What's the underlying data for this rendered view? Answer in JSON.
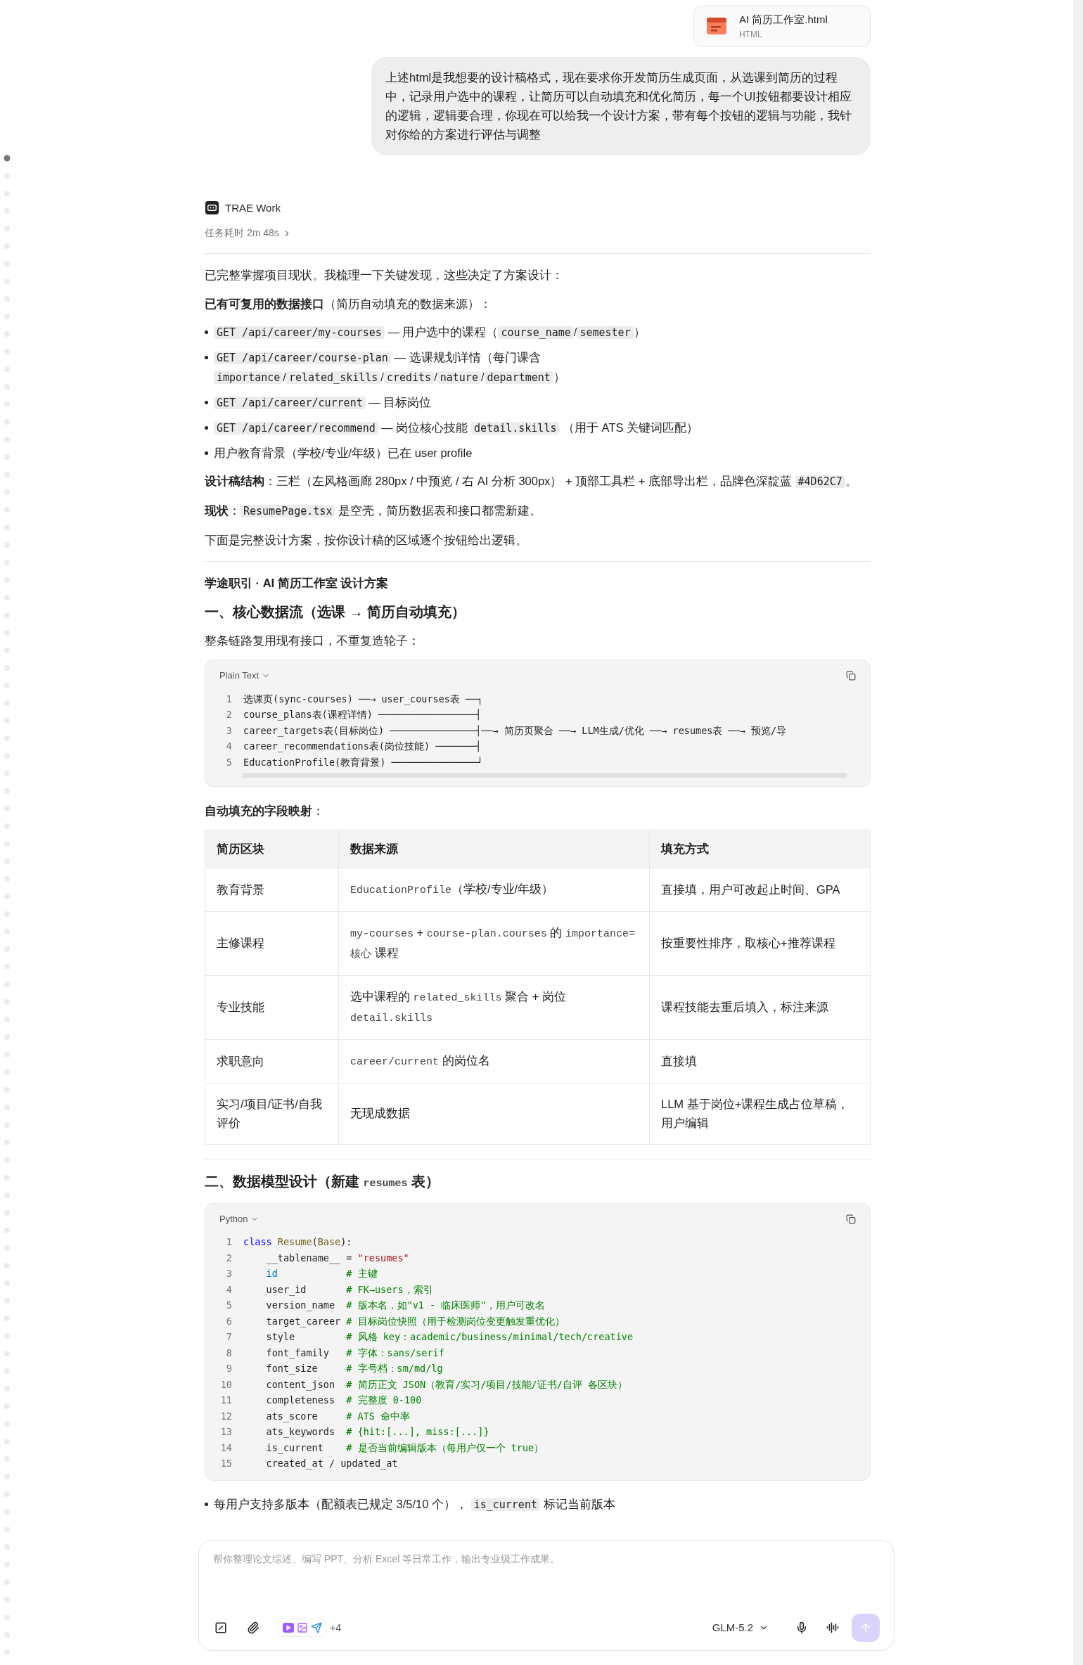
{
  "attachment": {
    "name": "AI 简历工作室.html",
    "type": "HTML"
  },
  "user_message": "上述html是我想要的设计稿格式，现在要求你开发简历生成页面，从选课到简历的过程中，记录用户选中的课程，让简历可以自动填充和优化简历，每一个UI按钮都要设计相应的逻辑，逻辑要合理，你现在可以给我一个设计方案，带有每个按钮的逻辑与功能，我针对你给的方案进行评估与调整",
  "assistant": {
    "name": "TRAE Work",
    "duration": "任务耗时 2m 48s"
  },
  "content": [
    {
      "kind": "divider"
    },
    {
      "kind": "paragraph",
      "segments": [
        {
          "kind": "text",
          "text": "已完整掌握项目现状。我梳理一下关键发现，这些决定了方案设计："
        }
      ]
    },
    {
      "kind": "paragraph",
      "segments": [
        {
          "kind": "text",
          "text": "**已有可复用的数据接口**（简历自动填充的数据来源）："
        }
      ]
    },
    {
      "kind": "bullets",
      "items": [
        {
          "segments": [
            {
              "kind": "code",
              "text": "GET /api/career/my-courses"
            },
            {
              "kind": "text",
              "text": " — 用户选中的课程（"
            },
            {
              "kind": "code",
              "text": "course_name"
            },
            {
              "kind": "text",
              "text": "/"
            },
            {
              "kind": "code",
              "text": "semester"
            },
            {
              "kind": "text",
              "text": "）"
            }
          ]
        },
        {
          "segments": [
            {
              "kind": "code",
              "text": "GET /api/career/course-plan"
            },
            {
              "kind": "text",
              "text": " — 选课规划详情（每门课含 "
            },
            {
              "kind": "code",
              "text": "importance"
            },
            {
              "kind": "text",
              "text": "/"
            },
            {
              "kind": "code",
              "text": "related_skills"
            },
            {
              "kind": "text",
              "text": "/"
            },
            {
              "kind": "code",
              "text": "credits"
            },
            {
              "kind": "text",
              "text": "/"
            },
            {
              "kind": "code",
              "text": "nature"
            },
            {
              "kind": "text",
              "text": "/"
            },
            {
              "kind": "code",
              "text": "department"
            },
            {
              "kind": "text",
              "text": "）"
            }
          ]
        },
        {
          "segments": [
            {
              "kind": "code",
              "text": "GET /api/career/current"
            },
            {
              "kind": "text",
              "text": " — 目标岗位"
            }
          ]
        },
        {
          "segments": [
            {
              "kind": "code",
              "text": "GET /api/career/recommend"
            },
            {
              "kind": "text",
              "text": " — 岗位核心技能 "
            },
            {
              "kind": "code",
              "text": "detail.skills"
            },
            {
              "kind": "text",
              "text": " （用于 ATS 关键词匹配）"
            }
          ]
        },
        {
          "segments": [
            {
              "kind": "text",
              "text": "用户教育背景（学校/专业/年级）已在 user profile"
            }
          ]
        }
      ]
    },
    {
      "kind": "paragraph",
      "segments": [
        {
          "kind": "text",
          "text": "**设计稿结构**：三栏（左风格画廊 280px / 中预览 / 右 AI 分析 300px） + 顶部工具栏 + 底部导出栏，品牌色深靛蓝 "
        },
        {
          "kind": "code",
          "text": "#4D62C7"
        },
        {
          "kind": "text",
          "text": "。"
        }
      ]
    },
    {
      "kind": "paragraph",
      "segments": [
        {
          "kind": "text",
          "text": "**现状**："
        },
        {
          "kind": "code",
          "text": "ResumePage.tsx"
        },
        {
          "kind": "text",
          "text": " 是空壳，简历数据表和接口都需新建。"
        }
      ]
    },
    {
      "kind": "paragraph",
      "segments": [
        {
          "kind": "text",
          "text": "下面是完整设计方案，按你设计稿的区域逐个按钮给出逻辑。"
        }
      ]
    },
    {
      "kind": "divider"
    },
    {
      "kind": "title",
      "segments": [
        {
          "kind": "text",
          "text": "学途职引 · AI 简历工作室 设计方案"
        }
      ]
    },
    {
      "kind": "heading",
      "segments": [
        {
          "kind": "text",
          "text": "一、核心数据流（选课 → 简历自动填充）"
        }
      ]
    },
    {
      "kind": "paragraph",
      "segments": [
        {
          "kind": "text",
          "text": "整条链路复用现有接口，不重复造轮子："
        }
      ]
    },
    {
      "kind": "code",
      "language": "Plain Text",
      "scrollable": true,
      "lines": [
        {
          "number": "1",
          "tokens": [
            {
              "kind": "plain",
              "text": "选课页(sync-courses) ──→ user_courses表 ──┐"
            }
          ]
        },
        {
          "number": "2",
          "tokens": [
            {
              "kind": "plain",
              "text": "course_plans表(课程详情) ─────────────────┤"
            }
          ]
        },
        {
          "number": "3",
          "tokens": [
            {
              "kind": "plain",
              "text": "career_targets表(目标岗位) ───────────────┤──→ 简历页聚合 ──→ LLM生成/优化 ──→ resumes表 ──→ 预览/导"
            }
          ]
        },
        {
          "number": "4",
          "tokens": [
            {
              "kind": "plain",
              "text": "career_recommendations表(岗位技能) ───────┤"
            }
          ]
        },
        {
          "number": "5",
          "tokens": [
            {
              "kind": "plain",
              "text": "EducationProfile(教育背景) ───────────────┘"
            }
          ]
        }
      ]
    },
    {
      "kind": "paragraph",
      "segments": [
        {
          "kind": "text",
          "text": "**自动填充的字段映射**："
        }
      ]
    },
    {
      "kind": "table",
      "columns": [
        "简历区块",
        "数据来源",
        "填充方式"
      ],
      "rows": [
        [
          [
            {
              "kind": "text",
              "text": "教育背景"
            }
          ],
          [
            {
              "kind": "mono",
              "text": "EducationProfile"
            },
            {
              "kind": "text",
              "text": "（学校/专业/年级）"
            }
          ],
          [
            {
              "kind": "text",
              "text": "直接填，用户可改起止时间、GPA"
            }
          ]
        ],
        [
          [
            {
              "kind": "text",
              "text": "主修课程"
            }
          ],
          [
            {
              "kind": "mono",
              "text": "my-courses"
            },
            {
              "kind": "text",
              "text": " + "
            },
            {
              "kind": "mono",
              "text": "course-plan.courses"
            },
            {
              "kind": "text",
              "text": " 的 "
            },
            {
              "kind": "mono",
              "text": "importance=核心"
            },
            {
              "kind": "text",
              "text": " 课程"
            }
          ],
          [
            {
              "kind": "text",
              "text": "按重要性排序，取核心+推荐课程"
            }
          ]
        ],
        [
          [
            {
              "kind": "text",
              "text": "专业技能"
            }
          ],
          [
            {
              "kind": "text",
              "text": "选中课程的 "
            },
            {
              "kind": "mono",
              "text": "related_skills"
            },
            {
              "kind": "text",
              "text": " 聚合 + 岗位 "
            },
            {
              "kind": "mono",
              "text": "detail.skills"
            }
          ],
          [
            {
              "kind": "text",
              "text": "课程技能去重后填入，标注来源"
            }
          ]
        ],
        [
          [
            {
              "kind": "text",
              "text": "求职意向"
            }
          ],
          [
            {
              "kind": "mono",
              "text": "career/current"
            },
            {
              "kind": "text",
              "text": " 的岗位名"
            }
          ],
          [
            {
              "kind": "text",
              "text": "直接填"
            }
          ]
        ],
        [
          [
            {
              "kind": "text",
              "text": "实习/项目/证书/自我评价"
            }
          ],
          [
            {
              "kind": "text",
              "text": "无现成数据"
            }
          ],
          [
            {
              "kind": "text",
              "text": "LLM 基于岗位+课程生成占位草稿，用户编辑"
            }
          ]
        ]
      ]
    },
    {
      "kind": "divider"
    },
    {
      "kind": "heading",
      "segments": [
        {
          "kind": "text",
          "text": "二、数据模型设计（新建 "
        },
        {
          "kind": "mono",
          "text": "resumes"
        },
        {
          "kind": "text",
          "text": " 表）"
        }
      ]
    },
    {
      "kind": "code",
      "language": "Python",
      "scrollable": false,
      "lines": [
        {
          "number": "1",
          "tokens": [
            {
              "kind": "keyword",
              "text": "class "
            },
            {
              "kind": "class",
              "text": "Resume"
            },
            {
              "kind": "plain",
              "text": "("
            },
            {
              "kind": "class",
              "text": "Base"
            },
            {
              "kind": "plain",
              "text": "):"
            }
          ]
        },
        {
          "number": "2",
          "tokens": [
            {
              "kind": "plain",
              "text": "    __tablename__ = "
            },
            {
              "kind": "string",
              "text": "\"resumes\""
            }
          ]
        },
        {
          "number": "3",
          "tokens": [
            {
              "kind": "builtin",
              "text": "    id"
            },
            {
              "kind": "comment",
              "text": "            # 主键"
            }
          ]
        },
        {
          "number": "4",
          "tokens": [
            {
              "kind": "plain",
              "text": "    user_id       "
            },
            {
              "kind": "comment",
              "text": "# FK→users，索引"
            }
          ]
        },
        {
          "number": "5",
          "tokens": [
            {
              "kind": "plain",
              "text": "    version_name  "
            },
            {
              "kind": "comment",
              "text": "# 版本名，如\"v1 - 临床医师\"，用户可改名"
            }
          ]
        },
        {
          "number": "6",
          "tokens": [
            {
              "kind": "plain",
              "text": "    target_career "
            },
            {
              "kind": "comment",
              "text": "# 目标岗位快照（用于检测岗位变更触发重优化）"
            }
          ]
        },
        {
          "number": "7",
          "tokens": [
            {
              "kind": "plain",
              "text": "    style         "
            },
            {
              "kind": "comment",
              "text": "# 风格 key：academic/business/minimal/tech/creative"
            }
          ]
        },
        {
          "number": "8",
          "tokens": [
            {
              "kind": "plain",
              "text": "    font_family   "
            },
            {
              "kind": "comment",
              "text": "# 字体：sans/serif"
            }
          ]
        },
        {
          "number": "9",
          "tokens": [
            {
              "kind": "plain",
              "text": "    font_size     "
            },
            {
              "kind": "comment",
              "text": "# 字号档：sm/md/lg"
            }
          ]
        },
        {
          "number": "10",
          "tokens": [
            {
              "kind": "plain",
              "text": "    content_json  "
            },
            {
              "kind": "comment",
              "text": "# 简历正文 JSON（教育/实习/项目/技能/证书/自评 各区块）"
            }
          ]
        },
        {
          "number": "11",
          "tokens": [
            {
              "kind": "plain",
              "text": "    completeness  "
            },
            {
              "kind": "comment",
              "text": "# 完整度 0-100"
            }
          ]
        },
        {
          "number": "12",
          "tokens": [
            {
              "kind": "plain",
              "text": "    ats_score     "
            },
            {
              "kind": "comment",
              "text": "# ATS 命中率"
            }
          ]
        },
        {
          "number": "13",
          "tokens": [
            {
              "kind": "plain",
              "text": "    ats_keywords  "
            },
            {
              "kind": "comment",
              "text": "# {hit:[...], miss:[...]}"
            }
          ]
        },
        {
          "number": "14",
          "tokens": [
            {
              "kind": "plain",
              "text": "    is_current    "
            },
            {
              "kind": "comment",
              "text": "# 是否当前编辑版本（每用户仅一个 true）"
            }
          ]
        },
        {
          "number": "15",
          "tokens": [
            {
              "kind": "plain",
              "text": "    created_at / updated_at"
            }
          ]
        }
      ]
    },
    {
      "kind": "bullets",
      "items": [
        {
          "segments": [
            {
              "kind": "text",
              "text": "每用户支持多版本（配额表已规定 3/5/10 个）， "
            },
            {
              "kind": "code",
              "text": "is_current"
            },
            {
              "kind": "text",
              "text": " 标记当前版本"
            }
          ]
        }
      ]
    }
  ],
  "composer": {
    "placeholder": "帮你整理论文综述、编写 PPT、分析 Excel 等日常工作，输出专业级工作成果。",
    "more_tools": "+4",
    "model": "GLM-5.2"
  }
}
